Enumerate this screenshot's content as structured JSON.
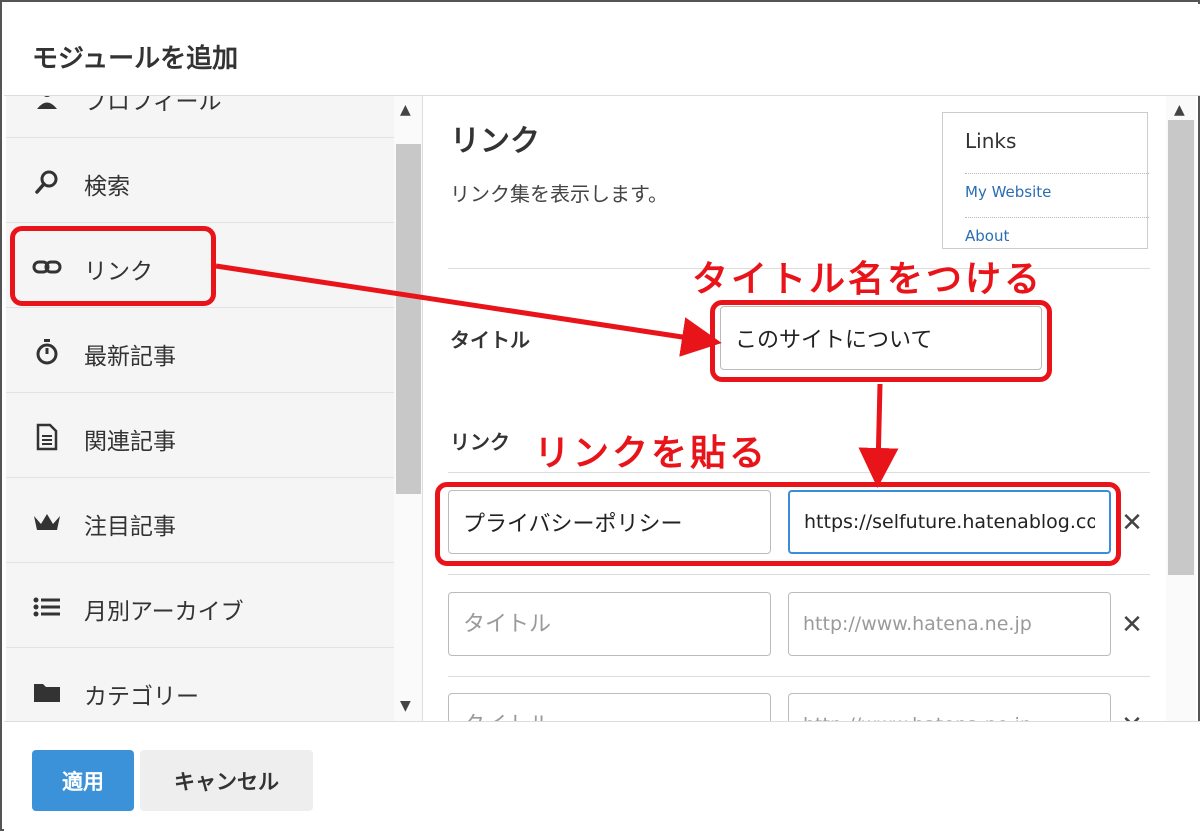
{
  "modal": {
    "title": "モジュールを追加"
  },
  "modules": [
    {
      "label": "プロフィール",
      "icon": "user-icon"
    },
    {
      "label": "検索",
      "icon": "search-icon"
    },
    {
      "label": "リンク",
      "icon": "link-icon"
    },
    {
      "label": "最新記事",
      "icon": "stopwatch-icon"
    },
    {
      "label": "関連記事",
      "icon": "document-icon"
    },
    {
      "label": "注目記事",
      "icon": "crown-icon"
    },
    {
      "label": "月別アーカイブ",
      "icon": "list-icon"
    },
    {
      "label": "カテゴリー",
      "icon": "folder-icon"
    }
  ],
  "panel": {
    "heading": "リンク",
    "description": "リンク集を表示します。",
    "preview": {
      "title": "Links",
      "links": [
        "My Website",
        "About"
      ]
    },
    "title_field": {
      "label": "タイトル",
      "value": "このサイトについて"
    },
    "links_field": {
      "label": "リンク",
      "rows": [
        {
          "title": "プライバシーポリシー",
          "url": "https://selfuture.hatenablog.com/privacy-policy",
          "title_placeholder": "タイトル",
          "url_placeholder": "http://www.hatena.ne.jp"
        },
        {
          "title": "",
          "url": "",
          "title_placeholder": "タイトル",
          "url_placeholder": "http://www.hatena.ne.jp"
        },
        {
          "title": "",
          "url": "",
          "title_placeholder": "タイトル",
          "url_placeholder": "http://www.hatena.ne.jp"
        }
      ],
      "remove_symbol": "✕"
    }
  },
  "footer": {
    "apply_label": "適用",
    "cancel_label": "キャンセル"
  },
  "annotations": {
    "title_note": "タイトル名をつける",
    "link_note": "リンクを貼る",
    "color": "#e8141a"
  },
  "colors": {
    "accent": "#3c92d9",
    "annotation": "#e8141a"
  }
}
